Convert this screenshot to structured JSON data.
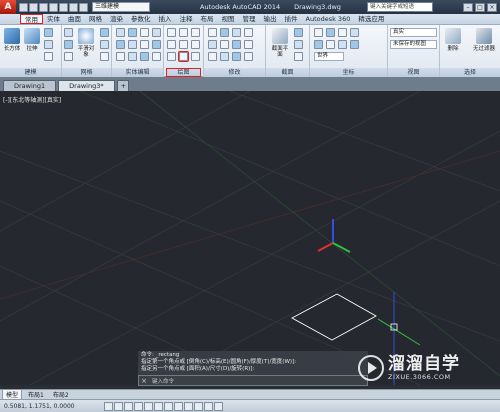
{
  "titlebar": {
    "app_logo": "A",
    "workspace": "三维建模",
    "app_title": "Autodesk AutoCAD 2014",
    "file_title": "Drawing3.dwg",
    "search_placeholder": "键入关键字或短语",
    "controls": [
      "–",
      "□",
      "×"
    ]
  },
  "ribbon_tabs": [
    "常用",
    "实体",
    "曲面",
    "网格",
    "渲染",
    "参数化",
    "插入",
    "注释",
    "布局",
    "视图",
    "管理",
    "输出",
    "插件",
    "Autodesk 360",
    "精选应用"
  ],
  "ribbon": {
    "box_label": "长方体",
    "extrude_label": "拉伸",
    "smooth_label": "平滑对象",
    "section_label": "截面平面",
    "view_label": "视图",
    "delete_label": "删除",
    "filter_label": "无过滤器",
    "render_style": "真实",
    "style_dropdown": "未保存的视图",
    "world": "世界",
    "panels": {
      "modeling": "建模",
      "mesh": "网格",
      "solid_edit": "实体编辑",
      "draw": "绘图",
      "modify": "修改",
      "section": "截面",
      "coords": "坐标",
      "view": "视图",
      "selection": "选择"
    }
  },
  "file_tabs": [
    "Drawing1",
    "Drawing3*"
  ],
  "viewport": {
    "label": "[-][东北等轴测][真实]"
  },
  "command": {
    "lines": [
      "命令: _rectang",
      "指定第一个角点或 [倒角(C)/标高(E)/圆角(F)/厚度(T)/宽度(W)]:",
      "指定另一个角点或 [面积(A)/尺寸(D)/旋转(R)]:"
    ],
    "close": "×",
    "placeholder": "键入命令"
  },
  "layout_tabs": [
    "模型",
    "布局1",
    "布局2"
  ],
  "status": {
    "coords": "0.5081,    1.1751,    0.0000"
  },
  "watermark": {
    "brand": "溜溜自学",
    "url": "ZIXUE.3066.COM"
  },
  "colors": {
    "accent_red": "#e02020",
    "x_axis": "#e03030",
    "y_axis": "#30c040",
    "z_axis": "#3050e0"
  }
}
